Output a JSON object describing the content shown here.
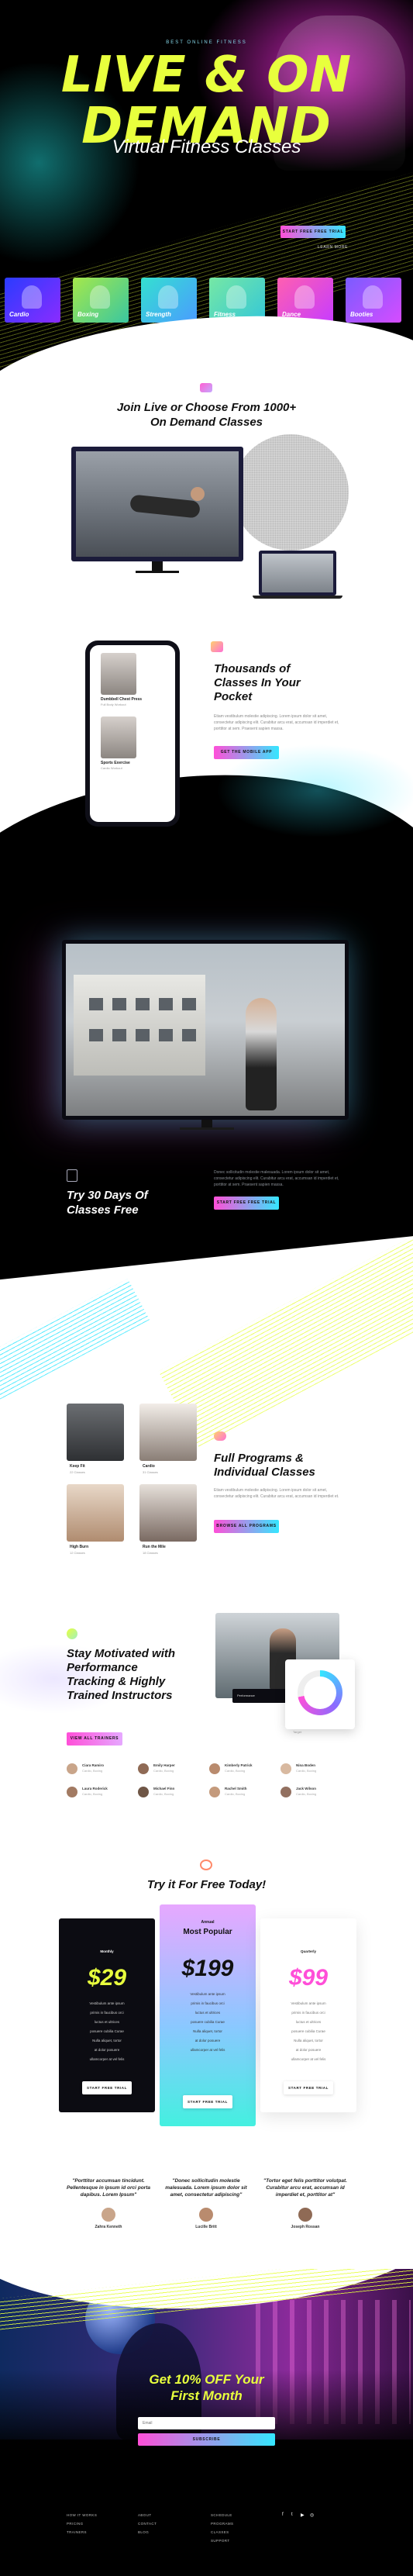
{
  "hero": {
    "eyebrow": "BEST ONLINE FITNESS",
    "title_line1": "LIVE & ON",
    "title_line2": "DEMAND",
    "subtitle": "Virtual Fitness Classes",
    "cta": "START FREE FREE TRIAL",
    "secondary_link": "LEARN MORE",
    "classes": [
      {
        "label": "Cardio",
        "color1": "#2a3cff",
        "color2": "#8a2cff"
      },
      {
        "label": "Boxing",
        "color1": "#a5e84a",
        "color2": "#3ac7a0"
      },
      {
        "label": "Strength",
        "color1": "#34e0d0",
        "color2": "#4a9cff"
      },
      {
        "label": "Fitness",
        "color1": "#76e8a4",
        "color2": "#34c7d8"
      },
      {
        "label": "Dance",
        "color1": "#ff5fb0",
        "color2": "#c73cff"
      },
      {
        "label": "Booties",
        "color1": "#7a5cff",
        "color2": "#d64cff"
      }
    ]
  },
  "join": {
    "title_line1": "Join Live or Choose From 1000+",
    "title_line2": "On Demand Classes"
  },
  "pocket": {
    "title_line1": "Thousands of",
    "title_line2": "Classes In Your",
    "title_line3": "Pocket",
    "text": "Etiam vestibulum molestie adipiscing. Lorem ipsum dolor sit amet, consectetur adipiscing elit. Curabitur arcu erat, accumsan id imperdiet et, porttitor at sem. Praesent sapien massa.",
    "button": "GET THE MOBILE APP",
    "phone_cards": [
      {
        "label": "Dumbbell Chest Press",
        "sub": "Full Body Workout"
      },
      {
        "label": "Sports Exercise",
        "sub": "Cardio Workout"
      }
    ]
  },
  "trial": {
    "title_line1": "Try 30 Days Of",
    "title_line2": "Classes Free",
    "text": "Donec sollicitudin molestie malesuada. Lorem ipsum dolor sit amet, consectetur adipiscing elit. Curabitur arcu erat, accumsan id imperdiet et, porttitor at sem. Praesent sapien massa.",
    "button": "START FREE FREE TRIAL"
  },
  "programs": {
    "cards": [
      {
        "label": "Keep Fit",
        "sub": "22 Classes"
      },
      {
        "label": "Cardio",
        "sub": "31 Classes"
      },
      {
        "label": "High Burn",
        "sub": "12 Classes"
      },
      {
        "label": "Run the Mile",
        "sub": "18 Classes"
      }
    ],
    "title_line1": "Full Programs &",
    "title_line2": "Individual Classes",
    "text": "Etiam vestibulum molestie adipiscing. Lorem ipsum dolor sit amet, consectetur adipiscing elit. Curabitur arcu erat, accumsan id imperdiet et.",
    "button": "BROWSE ALL PROGRAMS"
  },
  "motivated": {
    "title_line1": "Stay Motivated with",
    "title_line2": "Performance",
    "title_line3": "Tracking & Highly",
    "title_line4": "Trained Instructors",
    "text": "",
    "button": "VIEW ALL TRAINERS",
    "panel_label": "Performance",
    "ring_label": "Target",
    "ring_percent": 72,
    "instructors": [
      {
        "name": "Ciara Ramiro",
        "role": "Cardio, Boxing"
      },
      {
        "name": "Emily Harper",
        "role": "Cardio, Boxing"
      },
      {
        "name": "Kimberly Patrick",
        "role": "Cardio, Boxing"
      },
      {
        "name": "Nina Boden",
        "role": "Cardio, Boxing"
      },
      {
        "name": "Laura Roderick",
        "role": "Cardio, Boxing"
      },
      {
        "name": "Michael Finn",
        "role": "Cardio, Boxing"
      },
      {
        "name": "Rachel Smith",
        "role": "Cardio, Boxing"
      },
      {
        "name": "Jack Wilson",
        "role": "Cardio, Boxing"
      }
    ]
  },
  "pricing": {
    "title": "Try it For Free Today!",
    "plans": [
      {
        "name": "Monthly",
        "price": "$29",
        "features": [
          "Vestibulum ante ipsum",
          "primis in faucibus orci",
          "luctus et ultrices",
          "posuere cubilia Curae",
          "Nulla aliquet, tortor",
          "at dolor posuere",
          "ullamcorper at vel felis"
        ],
        "button": "START FREE TRIAL"
      },
      {
        "name": "Annual",
        "badge": "Most Popular",
        "price": "$199",
        "features": [
          "Vestibulum ante ipsum",
          "primis in faucibus orci",
          "luctus et ultrices",
          "posuere cubilia Curae",
          "Nulla aliquet, tortor",
          "at dolor posuere",
          "ullamcorper at vel felis"
        ],
        "button": "START FREE TRIAL"
      },
      {
        "name": "Quarterly",
        "price": "$99",
        "features": [
          "Vestibulum ante ipsum",
          "primis in faucibus orci",
          "luctus et ultrices",
          "posuere cubilia Curae",
          "Nulla aliquet, tortor",
          "at dolor posuere",
          "ullamcorper at vel felis"
        ],
        "button": "START FREE TRIAL"
      }
    ]
  },
  "testimonials": [
    {
      "quote": "\"Porttitor accumsan tincidunt. Pellentesque in ipsum id orci porta dapibus. Lorem Ipsum\"",
      "name": "Zahra Kenneth",
      "avatar_color": "#c9a58a"
    },
    {
      "quote": "\"Donec sollicitudin molestie malesuada. Lorem ipsum dolor sit amet, consectetur adipiscing\"",
      "name": "Lucille Britt",
      "avatar_color": "#b98b6e"
    },
    {
      "quote": "\"Tortor eget felis porttitor volutpat. Curabitur arcu erat, accumsan id imperdiet et, porttitor at\"",
      "name": "Joseph Rossan",
      "avatar_color": "#8f6a55"
    }
  ],
  "cta": {
    "title_line1": "Get 10% OFF Your",
    "title_line2": "First Month",
    "email_placeholder": "Email",
    "button": "SUBSCRIBE"
  },
  "footer": {
    "col1": [
      "HOW IT WORKS",
      "PRICING",
      "TRAINERS"
    ],
    "col2": [
      "ABOUT",
      "CONTACT",
      "BLOG"
    ],
    "col3": [
      "SCHEDULE",
      "PROGRAMS",
      "CLASSES",
      "SUPPORT"
    ],
    "social": [
      "f",
      "t",
      "▶",
      "◎"
    ]
  },
  "colors": {
    "accent_yellow": "#e8ff3d",
    "accent_pink": "#ff4fd8",
    "accent_cyan": "#34e7ff"
  }
}
